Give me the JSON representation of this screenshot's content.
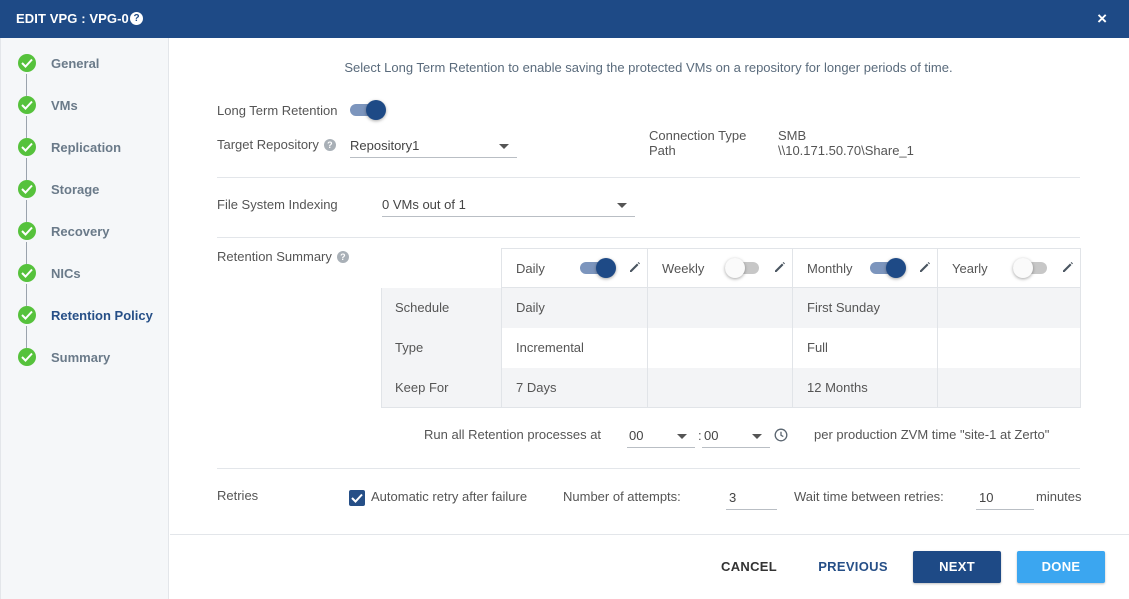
{
  "dialog": {
    "title": "EDIT VPG : VPG-0",
    "help_icon": "question-circle-icon",
    "close_glyph": "×",
    "colors": {
      "header": "#1e4a86",
      "accent": "#264f87",
      "step_done": "#56c23c",
      "done_button": "#3ba6f0"
    }
  },
  "sidebar": {
    "steps": [
      {
        "label": "General",
        "status": "complete"
      },
      {
        "label": "VMs",
        "status": "complete"
      },
      {
        "label": "Replication",
        "status": "complete"
      },
      {
        "label": "Storage",
        "status": "complete"
      },
      {
        "label": "Recovery",
        "status": "complete"
      },
      {
        "label": "NICs",
        "status": "complete"
      },
      {
        "label": "Retention Policy",
        "status": "complete",
        "active": true
      },
      {
        "label": "Summary",
        "status": "complete"
      }
    ]
  },
  "main": {
    "intro": "Select Long Term Retention to enable saving the protected VMs on a repository for longer periods of time.",
    "long_term_retention": {
      "label": "Long Term Retention",
      "enabled": true
    },
    "target_repository": {
      "label": "Target Repository",
      "value": "Repository1"
    },
    "connection": {
      "type_label": "Connection Type",
      "type_value": "SMB",
      "path_label": "Path",
      "path_value": "\\\\10.171.50.70\\Share_1"
    },
    "file_system_indexing": {
      "label": "File System Indexing",
      "value": "0 VMs out of 1"
    },
    "retention_summary": {
      "label": "Retention Summary",
      "columns": [
        {
          "label": "Daily",
          "enabled": true
        },
        {
          "label": "Weekly",
          "enabled": false
        },
        {
          "label": "Monthly",
          "enabled": true
        },
        {
          "label": "Yearly",
          "enabled": false
        }
      ],
      "rows": [
        {
          "label": "Schedule",
          "values": [
            "Daily",
            "",
            "First Sunday",
            ""
          ]
        },
        {
          "label": "Type",
          "values": [
            "Incremental",
            "",
            "Full",
            ""
          ]
        },
        {
          "label": "Keep For",
          "values": [
            "7 Days",
            "",
            "12 Months",
            ""
          ]
        }
      ]
    },
    "run_time": {
      "label": "Run all Retention processes at",
      "hours": "00",
      "separator": ":",
      "minutes": "00",
      "suffix": "per production ZVM time \"site-1 at Zerto\""
    },
    "retries": {
      "label": "Retries",
      "auto_retry_label": "Automatic retry after failure",
      "auto_retry_checked": true,
      "attempts_label": "Number of attempts:",
      "attempts_value": "3",
      "wait_label": "Wait time between retries:",
      "wait_value": "10",
      "wait_unit": "minutes"
    }
  },
  "footer": {
    "cancel": "CANCEL",
    "previous": "PREVIOUS",
    "next": "NEXT",
    "done": "DONE"
  }
}
